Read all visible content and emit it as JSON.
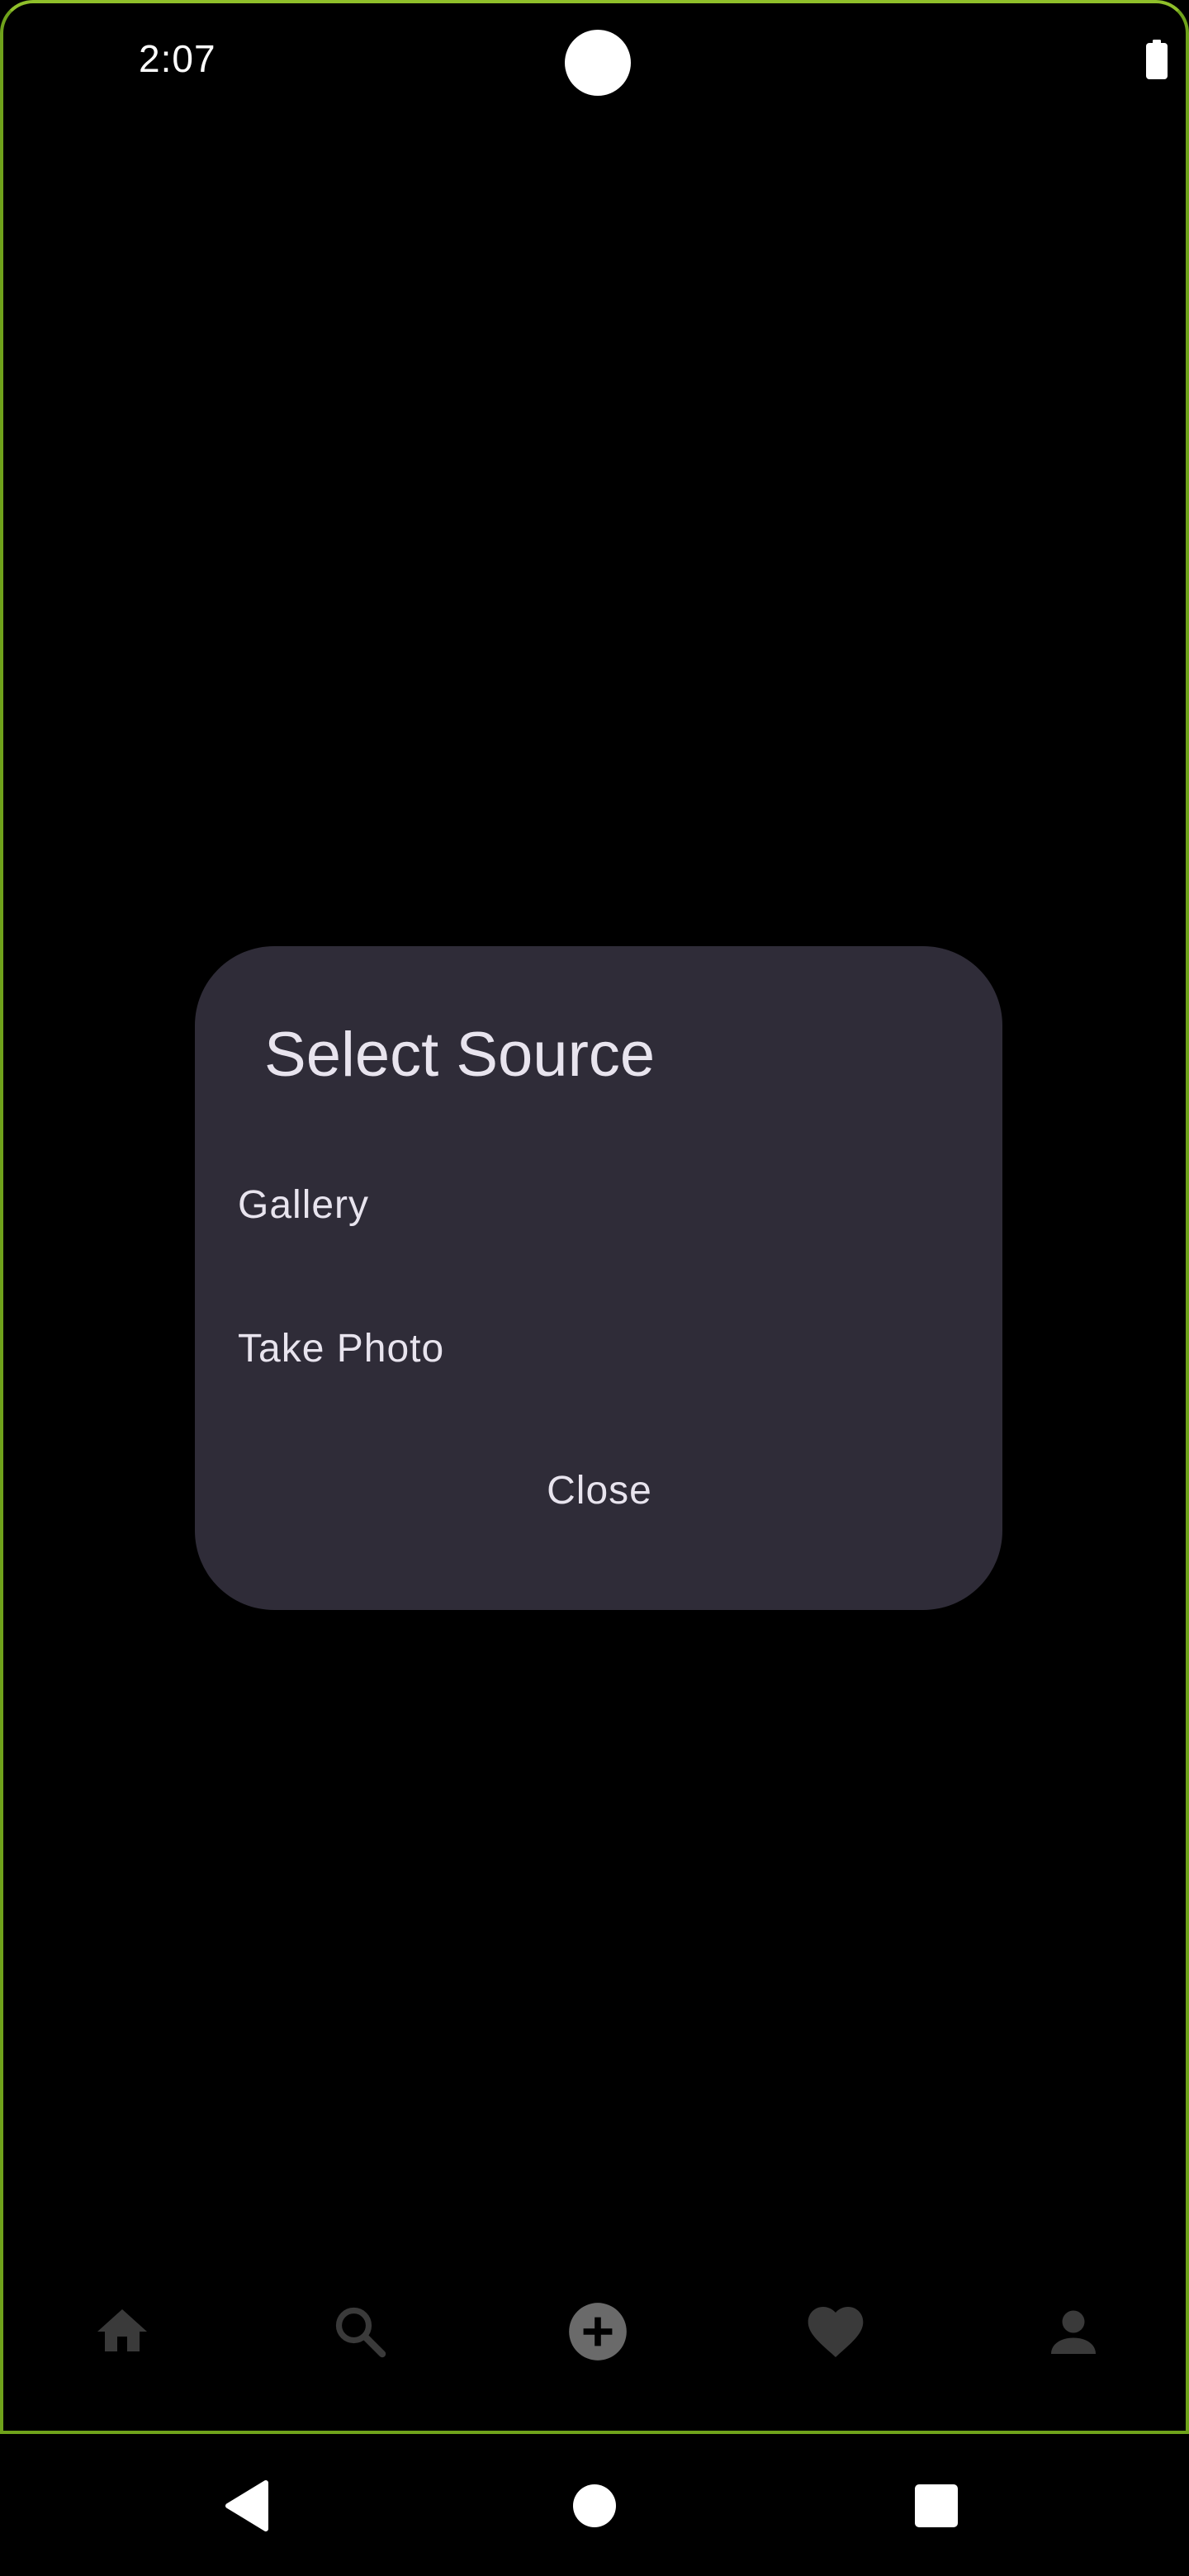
{
  "status_bar": {
    "time": "2:07",
    "icons": [
      "camera-cutout",
      "battery-icon"
    ]
  },
  "dialog": {
    "title": "Select Source",
    "options": [
      {
        "label": "Gallery"
      },
      {
        "label": "Take Photo"
      }
    ],
    "close_label": "Close"
  },
  "bottom_nav": {
    "items": [
      {
        "icon": "home-icon"
      },
      {
        "icon": "search-icon"
      },
      {
        "icon": "add-circle-icon"
      },
      {
        "icon": "heart-icon"
      },
      {
        "icon": "person-icon"
      }
    ]
  },
  "system_nav": {
    "items": [
      {
        "icon": "back-icon"
      },
      {
        "icon": "home-circle-icon"
      },
      {
        "icon": "recents-icon"
      }
    ]
  },
  "colors": {
    "background": "#000000",
    "dialog_bg": "#2f2c38",
    "dialog_text": "#e8e4ee",
    "nav_icon": "#3a3a3a",
    "device_border": "#6fa21b"
  }
}
